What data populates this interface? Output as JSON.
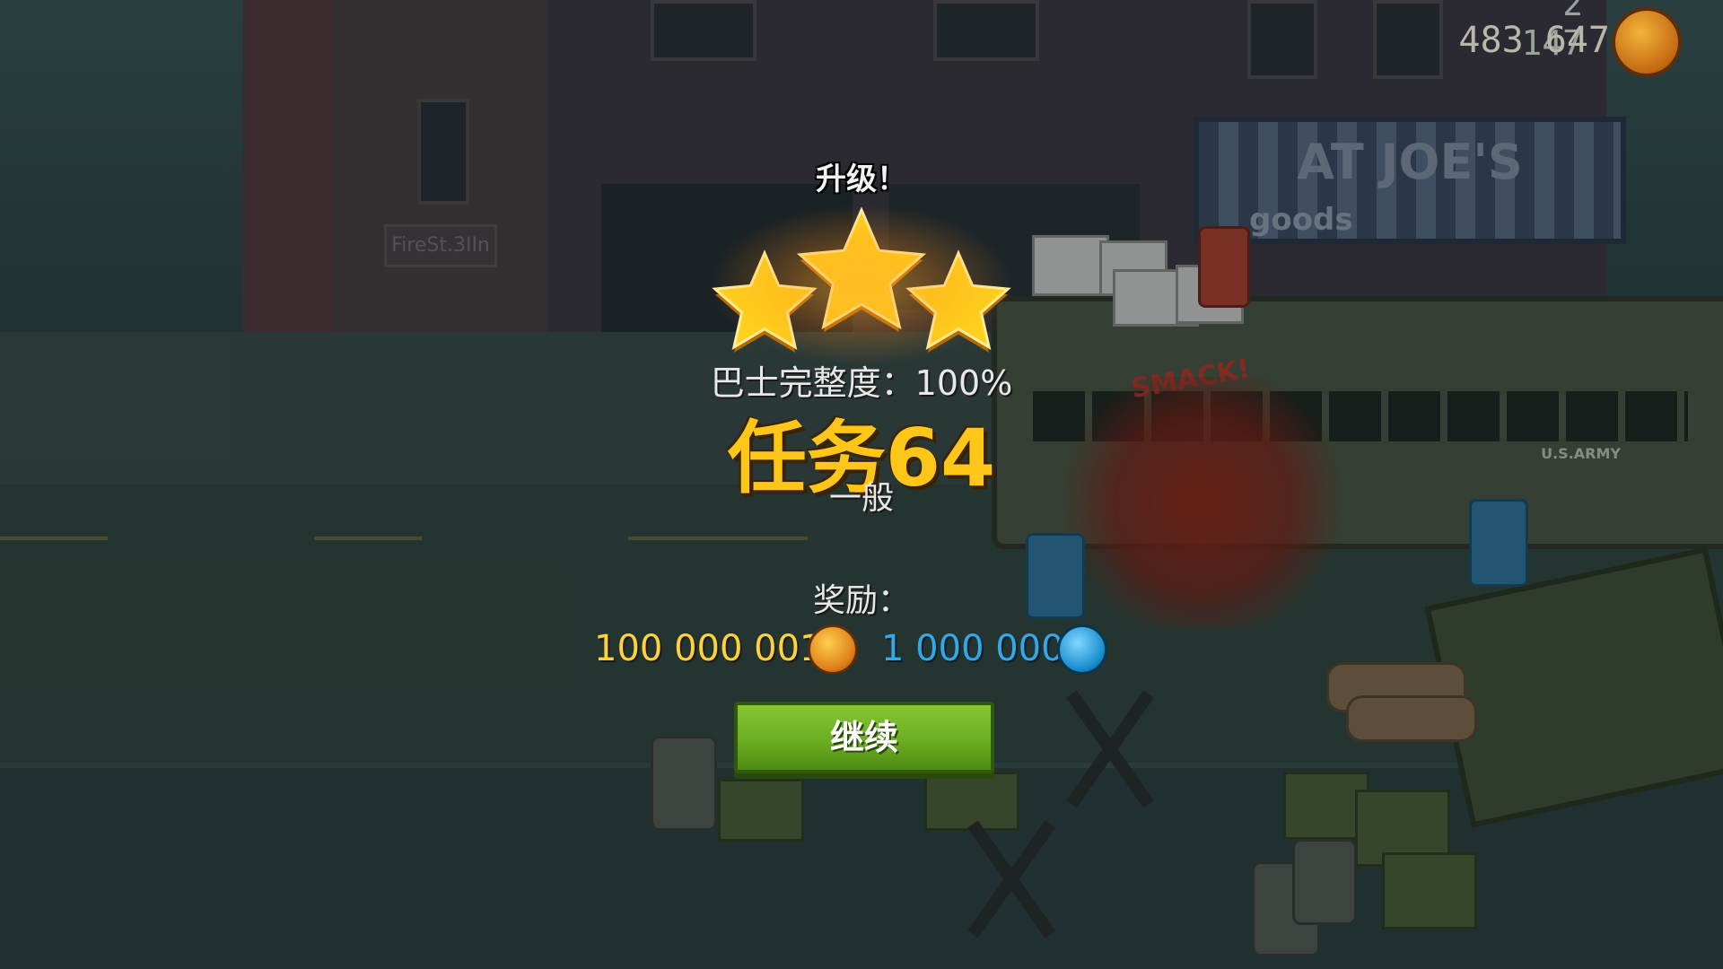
{
  "hud": {
    "top_value": "2 147",
    "coins": "483 647",
    "coin_icon": "skull-coin-icon"
  },
  "scene": {
    "shop_sign": "AT JOE'S",
    "shop_sign_sub": "goods",
    "station_plate": "FireSt.3IIn",
    "bus_label": "U.S.ARMY",
    "smack_text": "SMACK!"
  },
  "result": {
    "level_up": "升级！",
    "stars_earned": 3,
    "stars_total": 3,
    "bus_integrity": "巴士完整度：100%",
    "mission_title": "任务64",
    "difficulty": "一般",
    "reward_label": "奖励：",
    "reward_coins": "100 000 001",
    "reward_gems": "1 000 000",
    "continue_label": "继续"
  },
  "colors": {
    "mission_title": "#ffc61a",
    "coins_text": "#ffd23a",
    "gems_text": "#33a8e6",
    "continue_button": "#6cae22"
  }
}
